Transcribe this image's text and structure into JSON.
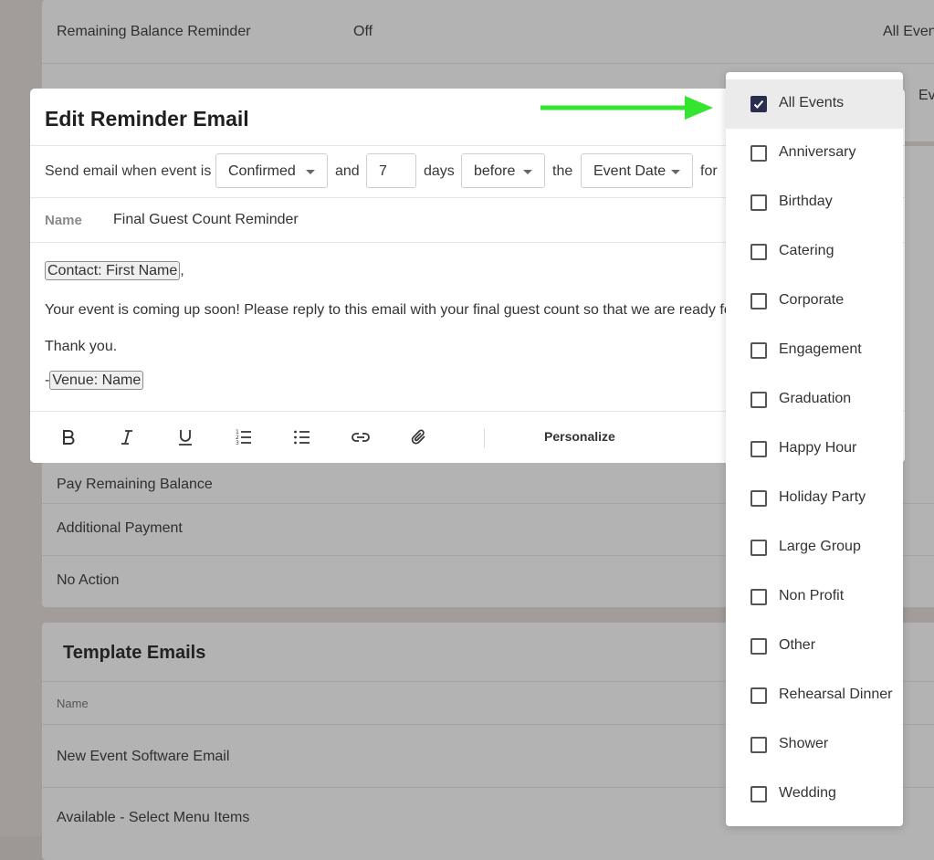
{
  "background": {
    "top_card": {
      "row1_label": "Remaining Balance Reminder",
      "row1_status": "Off",
      "row1_scope": "All Even",
      "row2_scope": "Even"
    },
    "action_rows": [
      "Pay Remaining Balance",
      "Additional Payment",
      "No Action"
    ],
    "template_emails": {
      "title": "Template Emails",
      "column_name": "Name",
      "rows": [
        "New Event Software Email",
        "Available - Select Menu Items"
      ]
    }
  },
  "modal": {
    "title": "Edit Reminder Email",
    "condition": {
      "prefix": "Send email when event is",
      "status_value": "Confirmed",
      "and_label": "and",
      "days_value": "7",
      "days_label": "days",
      "direction_value": "before",
      "the_label": "the",
      "date_field_value": "Event Date",
      "for_label": "for"
    },
    "name_label": "Name",
    "name_value": "Final Guest Count Reminder",
    "body": {
      "contact_tag": "Contact: First Name",
      "contact_suffix": ",",
      "line1": "Your event is coming up soon! Please reply to this email with your final guest count so that we are ready fo",
      "line2": "Thank you.",
      "sign_prefix": "-",
      "venue_tag": "Venue: Name"
    },
    "toolbar": {
      "personalize_label": "Personalize",
      "icons": [
        "bold-icon",
        "italic-icon",
        "underline-icon",
        "ordered-list-icon",
        "bullet-list-icon",
        "link-icon",
        "attachment-icon"
      ]
    }
  },
  "event_type_dropdown": {
    "options": [
      {
        "label": "All Events",
        "checked": true
      },
      {
        "label": "Anniversary",
        "checked": false
      },
      {
        "label": "Birthday",
        "checked": false
      },
      {
        "label": "Catering",
        "checked": false
      },
      {
        "label": "Corporate",
        "checked": false
      },
      {
        "label": "Engagement",
        "checked": false
      },
      {
        "label": "Graduation",
        "checked": false
      },
      {
        "label": "Happy Hour",
        "checked": false
      },
      {
        "label": "Holiday Party",
        "checked": false
      },
      {
        "label": "Large Group",
        "checked": false
      },
      {
        "label": "Non Profit",
        "checked": false
      },
      {
        "label": "Other",
        "checked": false
      },
      {
        "label": "Rehearsal Dinner",
        "checked": false
      },
      {
        "label": "Shower",
        "checked": false
      },
      {
        "label": "Wedding",
        "checked": false
      }
    ]
  },
  "colors": {
    "arrow": "#33e52e",
    "checkbox_checked": "#2a2d4f",
    "overlay": "#a29c9a"
  }
}
